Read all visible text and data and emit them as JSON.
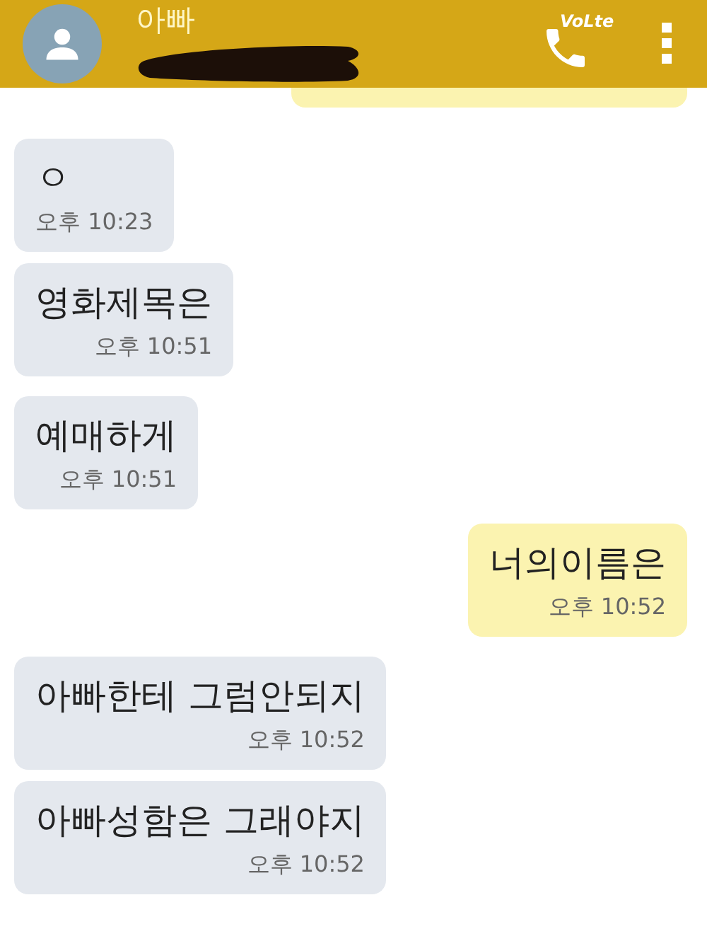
{
  "header": {
    "contact_name": "아빠",
    "call_badge": "VoLte"
  },
  "messages": [
    {
      "kind": "incoming",
      "text": "ㅇ",
      "time": "오후 10:23"
    },
    {
      "kind": "incoming",
      "text": "영화제목은",
      "time": "오후 10:51"
    },
    {
      "kind": "incoming",
      "text": "예매하게",
      "time": "오후 10:51"
    },
    {
      "kind": "outgoing",
      "text": "너의이름은",
      "time": "오후 10:52"
    },
    {
      "kind": "incoming",
      "text": "아빠한테 그럼안되지",
      "time": "오후 10:52"
    },
    {
      "kind": "incoming",
      "text": "아빠성함은 그래야지",
      "time": "오후 10:52"
    }
  ]
}
